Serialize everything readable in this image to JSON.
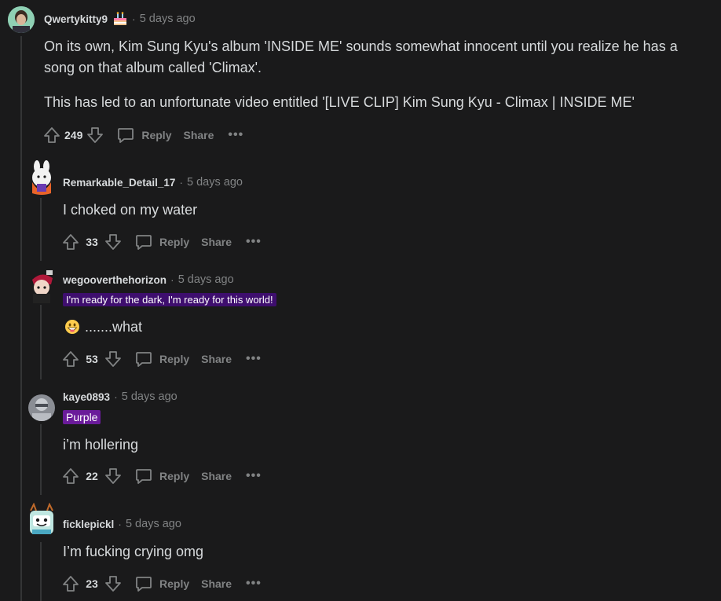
{
  "comments": [
    {
      "username": "Qwertykitty9",
      "timestamp": "5 days ago",
      "body_lines": [
        "On its own, Kim Sung Kyu's album 'INSIDE ME' sounds somewhat innocent until you realize he has a",
        "song on that album called 'Climax'.",
        "This has led to an unfortunate video entitled '[LIVE CLIP] Kim Sung Kyu - Climax | INSIDE ME'"
      ],
      "score": "249",
      "reply_label": "Reply",
      "share_label": "Share",
      "more_label": "•••",
      "award_icon": "cake-day-icon"
    },
    {
      "username": "Remarkable_Detail_17",
      "timestamp": "5 days ago",
      "body": "I choked on my water",
      "score": "33",
      "reply_label": "Reply",
      "share_label": "Share",
      "more_label": "•••"
    },
    {
      "username": "wegooverthehorizon",
      "timestamp": "5 days ago",
      "flair": "I'm ready for the dark, I'm ready for this world!",
      "flair_color": "#3e0e6e",
      "body": ".......what",
      "emoji": "grinning-face-icon",
      "score": "53",
      "reply_label": "Reply",
      "share_label": "Share",
      "more_label": "•••"
    },
    {
      "username": "kaye0893",
      "timestamp": "5 days ago",
      "flair": "Purple",
      "flair_color": "#6a1b9a",
      "body": "i’m hollering",
      "score": "22",
      "reply_label": "Reply",
      "share_label": "Share",
      "more_label": "•••"
    },
    {
      "username": "ficklepickl",
      "timestamp": "5 days ago",
      "body": "I’m fucking crying omg",
      "score": "23",
      "reply_label": "Reply",
      "share_label": "Share",
      "more_label": "•••"
    }
  ],
  "meta_separator": "·",
  "colors": {
    "background": "#1a1a1b",
    "text": "#d7dadc",
    "muted": "#818384",
    "thread_line": "#343536"
  }
}
